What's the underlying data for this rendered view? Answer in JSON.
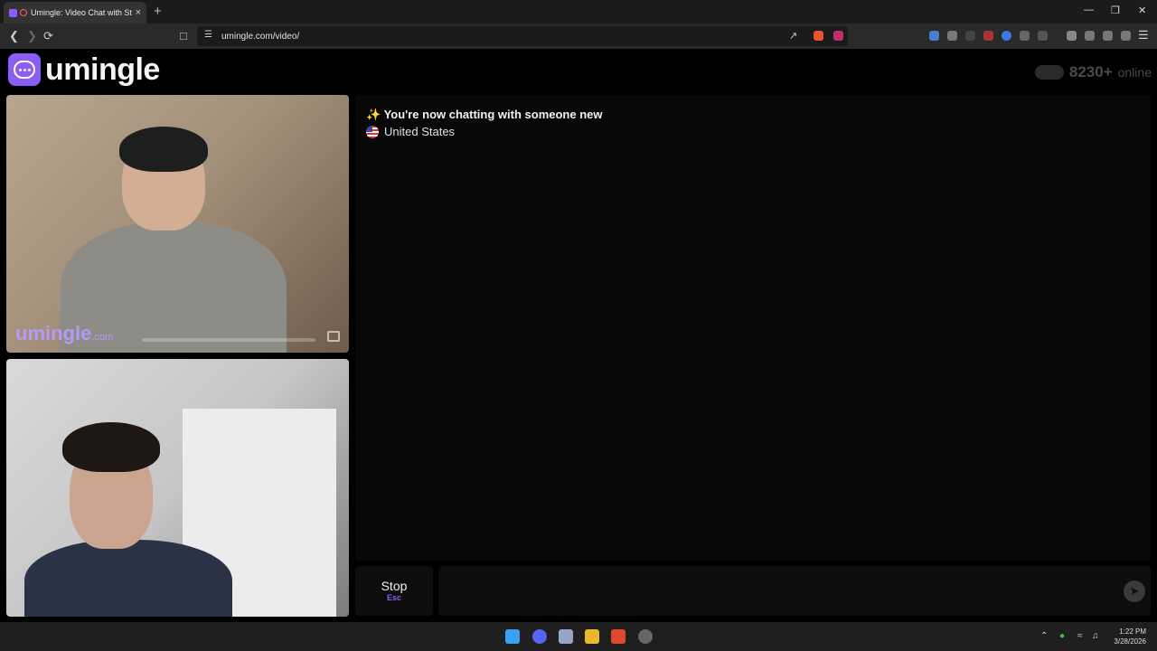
{
  "browser": {
    "tab_title": "Umingle: Video Chat with Stra",
    "new_tab": "+",
    "tab_close": "×",
    "url": "umingle.com/video/",
    "window_controls": [
      "—",
      "❐",
      "✕"
    ]
  },
  "app": {
    "logo_text": "umingle",
    "online_count": "8230+",
    "online_label": "online",
    "accent_color": "#8b5cf6"
  },
  "video": {
    "watermark_main": "umingle",
    "watermark_tld": ".com"
  },
  "chat": {
    "system_message": "✨ You're now chatting with someone new",
    "country": "United States"
  },
  "controls": {
    "stop_label": "Stop",
    "stop_shortcut": "Esc",
    "send_icon": "➤"
  },
  "taskbar": {
    "time": "1:22 PM",
    "date": "3/28/2026"
  }
}
